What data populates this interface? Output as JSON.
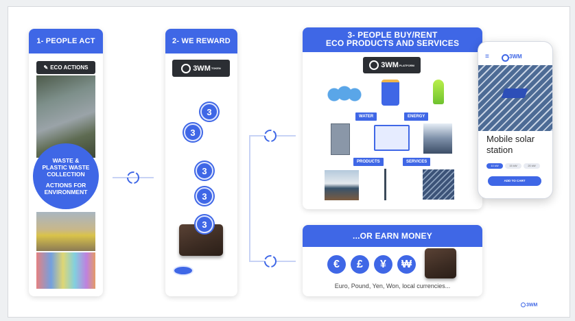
{
  "steps": {
    "act": {
      "title": "1- PEOPLE ACT",
      "badge": "ECO ACTIONS",
      "overlay_line1": "WASTE & PLASTIC WASTE COLLECTION",
      "overlay_line2": "ACTIONS FOR ENVIRONMENT"
    },
    "reward": {
      "title": "2- WE REWARD",
      "badge": "3WM",
      "badge_sup": "TOKEN"
    },
    "buy": {
      "title_line1": "3- PEOPLE BUY/RENT",
      "title_line2": "ECO PRODUCTS AND SERVICES",
      "badge": "3WM",
      "badge_sup": "PLATFORM",
      "labels": {
        "water": "WATER",
        "energy": "ENERGY",
        "products": "PRODUCTS",
        "services": "SERVICES"
      }
    },
    "earn": {
      "title": "...OR EARN MONEY",
      "currencies": [
        "€",
        "£",
        "¥",
        "₩"
      ],
      "caption": "Euro, Pound, Yen, Won, local currencies..."
    }
  },
  "phone": {
    "brand": "3WM",
    "product_name": "Mobile solar station",
    "size_chips": [
      "10 kW",
      "15 kW",
      "20 kW"
    ],
    "cta": "ADD TO CART"
  },
  "footer": {
    "logo": "3WM"
  },
  "colors": {
    "accent": "#3f67e6",
    "dark": "#2b2e33"
  }
}
